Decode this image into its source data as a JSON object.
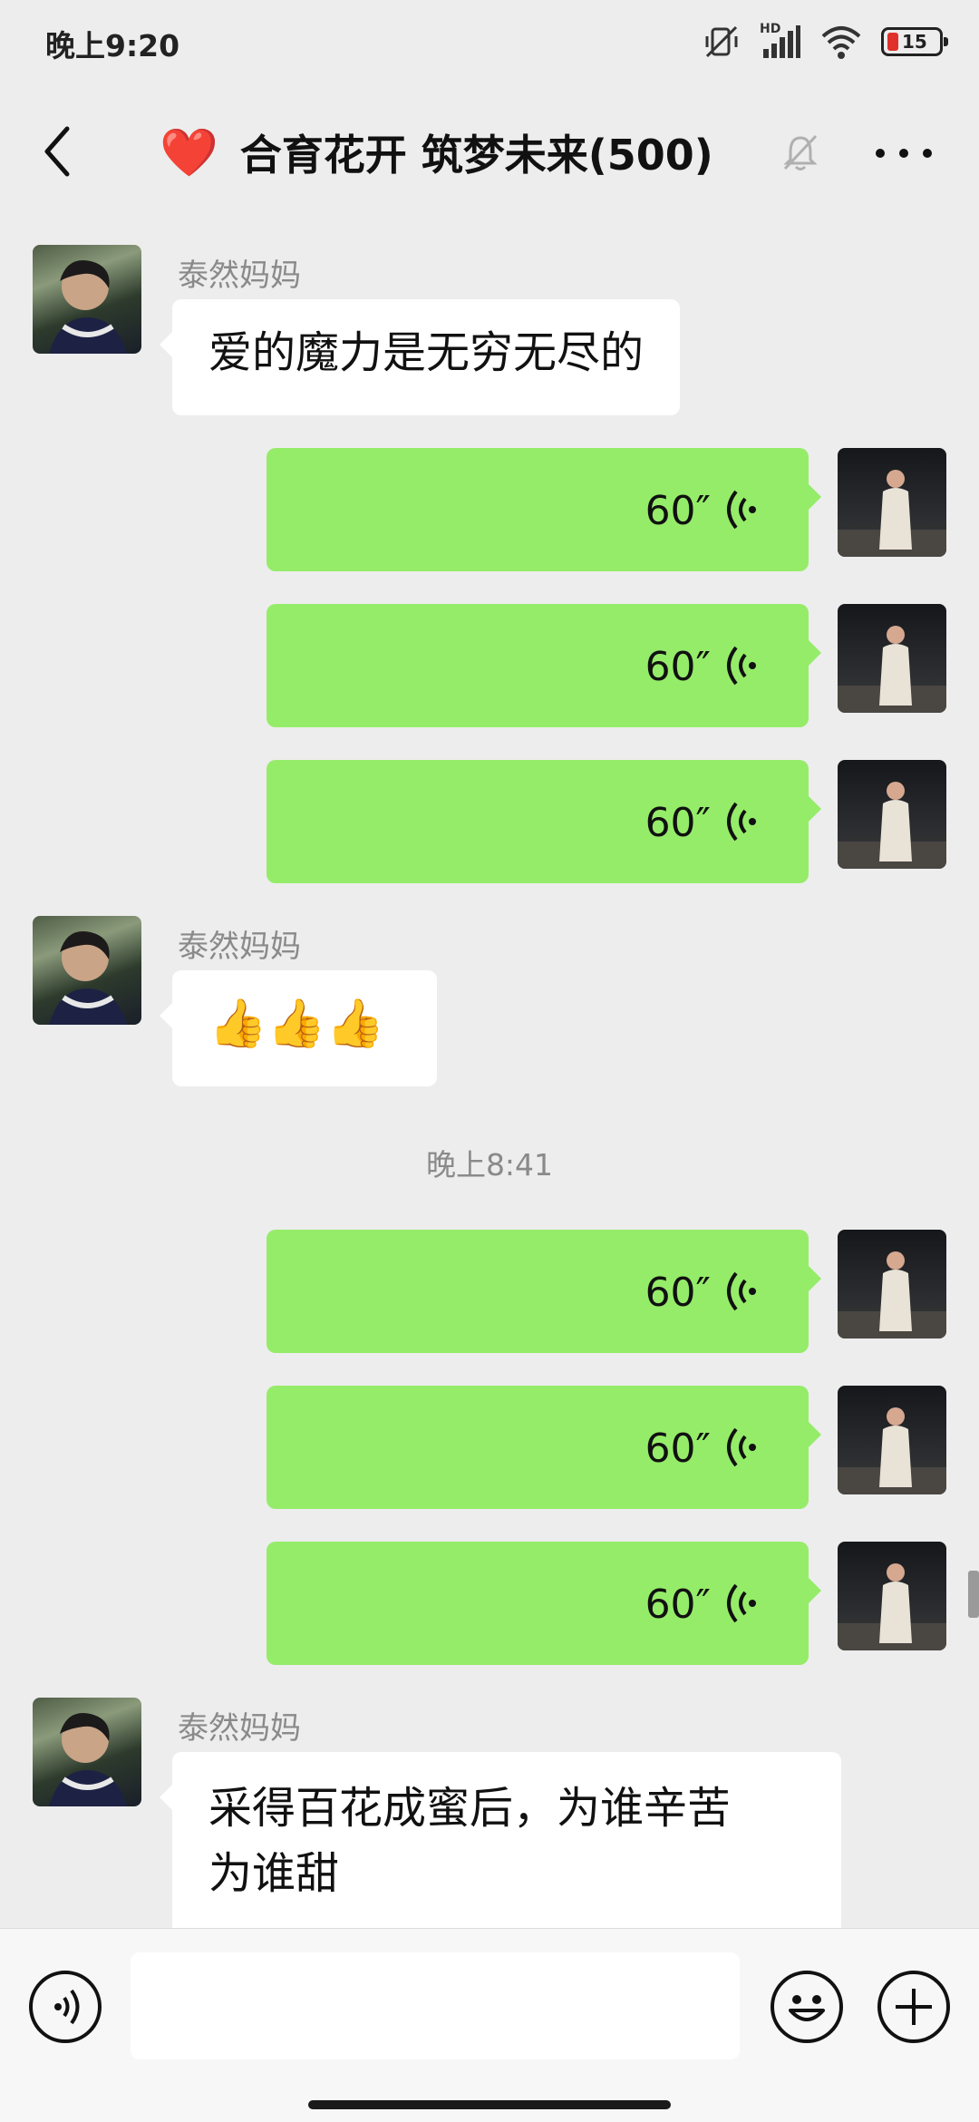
{
  "status_bar": {
    "time": "晚上9:20",
    "hd_label": "HD",
    "battery_level": "15"
  },
  "header": {
    "title_emoji": "❤️",
    "title": "合育花开 筑梦未来(500)"
  },
  "messages": [
    {
      "type": "text",
      "direction": "incoming",
      "sender": "泰然妈妈",
      "text": "爱的魔力是无穷无尽的"
    },
    {
      "type": "voice",
      "direction": "outgoing",
      "duration": "60″"
    },
    {
      "type": "voice",
      "direction": "outgoing",
      "duration": "60″"
    },
    {
      "type": "voice",
      "direction": "outgoing",
      "duration": "60″"
    },
    {
      "type": "text",
      "direction": "incoming",
      "sender": "泰然妈妈",
      "text": "👍👍👍"
    },
    {
      "type": "timestamp",
      "text": "晚上8:41"
    },
    {
      "type": "voice",
      "direction": "outgoing",
      "duration": "60″"
    },
    {
      "type": "voice",
      "direction": "outgoing",
      "duration": "60″"
    },
    {
      "type": "voice",
      "direction": "outgoing",
      "duration": "60″"
    },
    {
      "type": "text",
      "direction": "incoming",
      "sender": "泰然妈妈",
      "text_line1": "采得百花成蜜后，为谁辛苦",
      "text_line2": "为谁甜"
    }
  ],
  "input_bar": {
    "value": "",
    "placeholder": ""
  },
  "icons": {
    "back": "back-arrow-icon",
    "mute": "bell-muted-icon",
    "more": "more-dots-icon",
    "voice_mode": "voice-input-icon",
    "emoji": "emoji-face-icon",
    "add": "plus-icon"
  },
  "colors": {
    "background": "#ededed",
    "outgoing_bubble": "#95ec69",
    "incoming_bubble": "#ffffff",
    "battery_low": "#e0302a"
  }
}
